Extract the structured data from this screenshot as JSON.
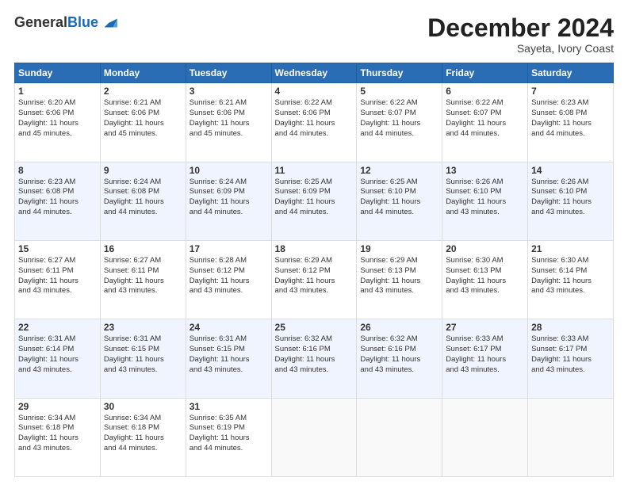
{
  "header": {
    "logo_line1": "General",
    "logo_line2": "Blue",
    "month": "December 2024",
    "location": "Sayeta, Ivory Coast"
  },
  "days_of_week": [
    "Sunday",
    "Monday",
    "Tuesday",
    "Wednesday",
    "Thursday",
    "Friday",
    "Saturday"
  ],
  "weeks": [
    [
      {
        "day": "1",
        "info": "Sunrise: 6:20 AM\nSunset: 6:06 PM\nDaylight: 11 hours\nand 45 minutes."
      },
      {
        "day": "2",
        "info": "Sunrise: 6:21 AM\nSunset: 6:06 PM\nDaylight: 11 hours\nand 45 minutes."
      },
      {
        "day": "3",
        "info": "Sunrise: 6:21 AM\nSunset: 6:06 PM\nDaylight: 11 hours\nand 45 minutes."
      },
      {
        "day": "4",
        "info": "Sunrise: 6:22 AM\nSunset: 6:06 PM\nDaylight: 11 hours\nand 44 minutes."
      },
      {
        "day": "5",
        "info": "Sunrise: 6:22 AM\nSunset: 6:07 PM\nDaylight: 11 hours\nand 44 minutes."
      },
      {
        "day": "6",
        "info": "Sunrise: 6:22 AM\nSunset: 6:07 PM\nDaylight: 11 hours\nand 44 minutes."
      },
      {
        "day": "7",
        "info": "Sunrise: 6:23 AM\nSunset: 6:08 PM\nDaylight: 11 hours\nand 44 minutes."
      }
    ],
    [
      {
        "day": "8",
        "info": "Sunrise: 6:23 AM\nSunset: 6:08 PM\nDaylight: 11 hours\nand 44 minutes."
      },
      {
        "day": "9",
        "info": "Sunrise: 6:24 AM\nSunset: 6:08 PM\nDaylight: 11 hours\nand 44 minutes."
      },
      {
        "day": "10",
        "info": "Sunrise: 6:24 AM\nSunset: 6:09 PM\nDaylight: 11 hours\nand 44 minutes."
      },
      {
        "day": "11",
        "info": "Sunrise: 6:25 AM\nSunset: 6:09 PM\nDaylight: 11 hours\nand 44 minutes."
      },
      {
        "day": "12",
        "info": "Sunrise: 6:25 AM\nSunset: 6:10 PM\nDaylight: 11 hours\nand 44 minutes."
      },
      {
        "day": "13",
        "info": "Sunrise: 6:26 AM\nSunset: 6:10 PM\nDaylight: 11 hours\nand 43 minutes."
      },
      {
        "day": "14",
        "info": "Sunrise: 6:26 AM\nSunset: 6:10 PM\nDaylight: 11 hours\nand 43 minutes."
      }
    ],
    [
      {
        "day": "15",
        "info": "Sunrise: 6:27 AM\nSunset: 6:11 PM\nDaylight: 11 hours\nand 43 minutes."
      },
      {
        "day": "16",
        "info": "Sunrise: 6:27 AM\nSunset: 6:11 PM\nDaylight: 11 hours\nand 43 minutes."
      },
      {
        "day": "17",
        "info": "Sunrise: 6:28 AM\nSunset: 6:12 PM\nDaylight: 11 hours\nand 43 minutes."
      },
      {
        "day": "18",
        "info": "Sunrise: 6:29 AM\nSunset: 6:12 PM\nDaylight: 11 hours\nand 43 minutes."
      },
      {
        "day": "19",
        "info": "Sunrise: 6:29 AM\nSunset: 6:13 PM\nDaylight: 11 hours\nand 43 minutes."
      },
      {
        "day": "20",
        "info": "Sunrise: 6:30 AM\nSunset: 6:13 PM\nDaylight: 11 hours\nand 43 minutes."
      },
      {
        "day": "21",
        "info": "Sunrise: 6:30 AM\nSunset: 6:14 PM\nDaylight: 11 hours\nand 43 minutes."
      }
    ],
    [
      {
        "day": "22",
        "info": "Sunrise: 6:31 AM\nSunset: 6:14 PM\nDaylight: 11 hours\nand 43 minutes."
      },
      {
        "day": "23",
        "info": "Sunrise: 6:31 AM\nSunset: 6:15 PM\nDaylight: 11 hours\nand 43 minutes."
      },
      {
        "day": "24",
        "info": "Sunrise: 6:31 AM\nSunset: 6:15 PM\nDaylight: 11 hours\nand 43 minutes."
      },
      {
        "day": "25",
        "info": "Sunrise: 6:32 AM\nSunset: 6:16 PM\nDaylight: 11 hours\nand 43 minutes."
      },
      {
        "day": "26",
        "info": "Sunrise: 6:32 AM\nSunset: 6:16 PM\nDaylight: 11 hours\nand 43 minutes."
      },
      {
        "day": "27",
        "info": "Sunrise: 6:33 AM\nSunset: 6:17 PM\nDaylight: 11 hours\nand 43 minutes."
      },
      {
        "day": "28",
        "info": "Sunrise: 6:33 AM\nSunset: 6:17 PM\nDaylight: 11 hours\nand 43 minutes."
      }
    ],
    [
      {
        "day": "29",
        "info": "Sunrise: 6:34 AM\nSunset: 6:18 PM\nDaylight: 11 hours\nand 43 minutes."
      },
      {
        "day": "30",
        "info": "Sunrise: 6:34 AM\nSunset: 6:18 PM\nDaylight: 11 hours\nand 44 minutes."
      },
      {
        "day": "31",
        "info": "Sunrise: 6:35 AM\nSunset: 6:19 PM\nDaylight: 11 hours\nand 44 minutes."
      },
      {
        "day": "",
        "info": ""
      },
      {
        "day": "",
        "info": ""
      },
      {
        "day": "",
        "info": ""
      },
      {
        "day": "",
        "info": ""
      }
    ]
  ]
}
